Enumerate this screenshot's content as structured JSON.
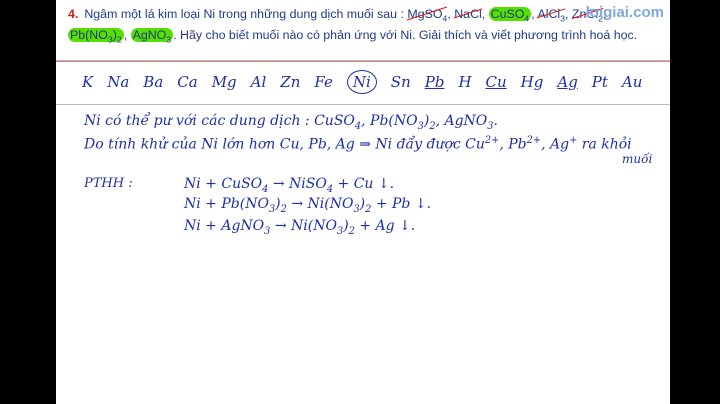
{
  "question": {
    "number": "4.",
    "text_before": "Ngâm một lá kim loại Ni trong những dung dịch muối sau : ",
    "salts": {
      "s1": "MgSO",
      "s1sub": "4",
      "s2": "NaCl",
      "s3": "CuSO",
      "s3sub": "4",
      "s4": "AlCl",
      "s4sub": "3",
      "s5": "ZnCl",
      "s5sub": "2",
      "s6": "Pb(NO",
      "s6sub": "3",
      "s6end": ")",
      "s6sub2": "2",
      "s7": "AgNO",
      "s7sub": "3"
    },
    "text_after": "Hãy cho biết muối nào có phản ứng với Ni. Giải thích và viết phương trình hoá học."
  },
  "watermark": "loigiai.com",
  "activity_series": [
    "K",
    "Na",
    "Ba",
    "Ca",
    "Mg",
    "Al",
    "Zn",
    "Fe",
    "Ni",
    "Sn",
    "Pb",
    "H",
    "Cu",
    "Hg",
    "Ag",
    "Pt",
    "Au"
  ],
  "handwriting": {
    "line1_a": "Ni có thể pư với các dung dịch :  CuSO",
    "line1_a_sub": "4",
    "line1_b": ",  Pb(NO",
    "line1_b_sub": "3",
    "line1_c": ")",
    "line1_c_sub": "2",
    "line1_d": ",  AgNO",
    "line1_d_sub": "3",
    "line1_e": ".",
    "line2_a": "Do tính khử của Ni lớn hơn Cu, Pb, Ag   ⇒  Ni đẩy được  Cu",
    "line2_a_sup": "2+",
    "line2_b": ", Pb",
    "line2_b_sup": "2+",
    "line2_c": ", Ag",
    "line2_c_sup": "+",
    "line2_d": " ra khỏi",
    "line2_end": "muối",
    "pthh_label": "PTHH :",
    "eq1": {
      "a": "Ni  +  CuSO",
      "a_sub": "4",
      "b": "  →   NiSO",
      "b_sub": "4",
      "c": "  +   Cu ↓."
    },
    "eq2": {
      "a": "Ni  +  Pb(NO",
      "a_sub": "3",
      "a2": ")",
      "a2_sub": "2",
      "b": "  →   Ni(NO",
      "b_sub": "3",
      "b2": ")",
      "b2_sub": "2",
      "c": "  +   Pb ↓."
    },
    "eq3": {
      "a": "Ni  +  AgNO",
      "a_sub": "3",
      "b": "  →   Ni(NO",
      "b_sub": "3",
      "b2": ")",
      "b2_sub": "2",
      "c": "  +   Ag ↓."
    }
  }
}
